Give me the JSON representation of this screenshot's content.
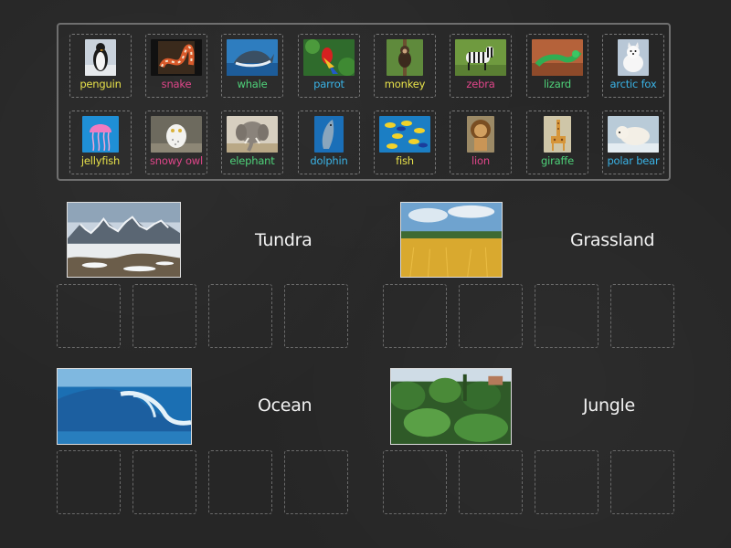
{
  "bank": {
    "cards": [
      {
        "label": "penguin",
        "color": "#e8e24a",
        "icon": "penguin-photo"
      },
      {
        "label": "snake",
        "color": "#e0468a",
        "icon": "snake-photo"
      },
      {
        "label": "whale",
        "color": "#4fd37a",
        "icon": "whale-photo"
      },
      {
        "label": "parrot",
        "color": "#3ab3e6",
        "icon": "parrot-photo"
      },
      {
        "label": "monkey",
        "color": "#e8e24a",
        "icon": "monkey-photo"
      },
      {
        "label": "zebra",
        "color": "#e0468a",
        "icon": "zebra-photo"
      },
      {
        "label": "lizard",
        "color": "#4fd37a",
        "icon": "lizard-photo"
      },
      {
        "label": "arctic fox",
        "color": "#3ab3e6",
        "icon": "arctic-fox-photo"
      },
      {
        "label": "jellyfish",
        "color": "#e8e24a",
        "icon": "jellyfish-photo"
      },
      {
        "label": "snowy owl",
        "color": "#e0468a",
        "icon": "snowy-owl-photo"
      },
      {
        "label": "elephant",
        "color": "#4fd37a",
        "icon": "elephant-photo"
      },
      {
        "label": "dolphin",
        "color": "#3ab3e6",
        "icon": "dolphin-photo"
      },
      {
        "label": "fish",
        "color": "#e8e24a",
        "icon": "fish-photo"
      },
      {
        "label": "lion",
        "color": "#e0468a",
        "icon": "lion-photo"
      },
      {
        "label": "giraffe",
        "color": "#4fd37a",
        "icon": "giraffe-photo"
      },
      {
        "label": "polar bear",
        "color": "#3ab3e6",
        "icon": "polar-bear-photo"
      }
    ]
  },
  "categories": [
    {
      "title": "Tundra",
      "icon": "tundra-photo"
    },
    {
      "title": "Grassland",
      "icon": "grassland-photo"
    },
    {
      "title": "Ocean",
      "icon": "ocean-photo"
    },
    {
      "title": "Jungle",
      "icon": "jungle-photo"
    }
  ]
}
